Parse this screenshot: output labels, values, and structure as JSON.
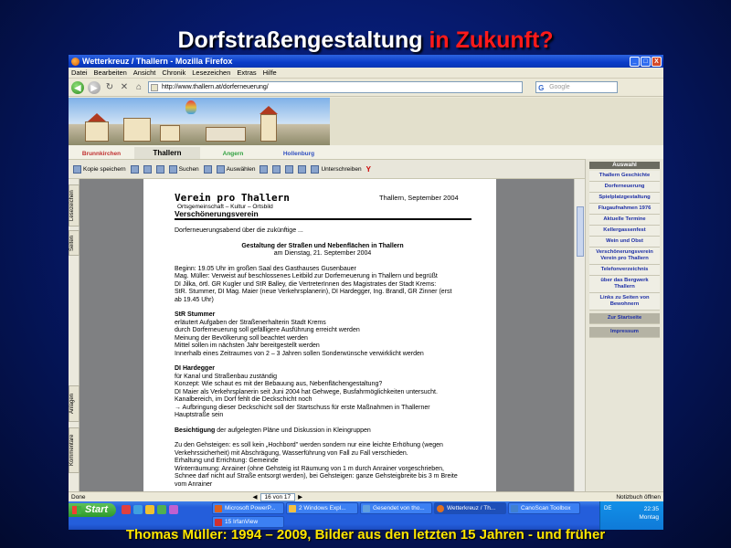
{
  "slide": {
    "title_main": "Dorfstraßengestaltung ",
    "title_highlight": "in Zukunft?",
    "footer": "Thomas Müller: 1994 – 2009, Bilder aus den letzten 15 Jahren - und früher"
  },
  "window": {
    "title": "Wetterkreuz / Thallern - Mozilla Firefox",
    "controls": [
      "_",
      "□",
      "X"
    ]
  },
  "menu": [
    "Datei",
    "Bearbeiten",
    "Ansicht",
    "Chronik",
    "Lesezeichen",
    "Extras",
    "Hilfe"
  ],
  "nav": {
    "url": "http://www.thallern.at/dorferneuerung/",
    "search_placeholder": "Google"
  },
  "site_tabs": [
    "Brunnkirchen",
    "Thallern",
    "Angern",
    "Hollenburg"
  ],
  "pdf_toolbar": [
    "Kopie speichern",
    "Suchen",
    "Auswählen",
    "Unterschreiben"
  ],
  "side_tabs": [
    "Lesezeichen",
    "Seiten",
    "Anlagen",
    "Kommentare"
  ],
  "document": {
    "org": "Verein pro Thallern",
    "org_sub": "Ortsgemeinschaft – Kultur – Ortsbild",
    "org_name": "Verschönerungsverein",
    "date": "Thallern,  September 2004",
    "intro": "Dorferneuerungsabend über die zukünftige ...",
    "heading1": "Gestaltung der Straßen und Nebenflächen in Thallern",
    "heading2": "am Dienstag, 21. September 2004",
    "p1": [
      "Beginn: 19.05 Uhr im großen Saal des Gasthauses Gusenbauer",
      "Mag. Müller: Verweist auf beschlossenes Leitbild zur Dorferneuerung in Thallern und begrüßt",
      "DI Jilka, örtl. GR Kugler und StR Balley, die VertreterInnen des Magistrates der Stadt Krems:",
      "StR. Stummer, DI Mag. Maier (neue Verkehrsplanerin), DI Hardegger, Ing. Brandl, GR Zinner (erst",
      "ab 19.45 Uhr)"
    ],
    "s2_title": "StR Stummer",
    "p2": [
      "erläutert Aufgaben der Straßenerhalterin Stadt Krems",
      "durch Dorferneuerung soll gefälligere Ausführung  erreicht werden",
      "Meinung der Bevölkerung soll beachtet werden",
      "Mittel sollen im nächsten Jahr  bereitgestellt werden",
      "Innerhalb eines Zeitraumes von  2 – 3 Jahren sollen Sonderwünsche verwirklicht werden"
    ],
    "s3_title": "DI Hardegger",
    "p3": [
      "für Kanal und Straßenbau zuständig",
      "Konzept: Wie schaut es mit der Bebauung aus, Nebenflächengestaltung?",
      "DI Maier  als Verkehrsplanerin seit Juni 2004 hat Gehwege, Busfahrmöglichkeiten untersucht.",
      "Kanalbereich, im Dorf fehlt die Deckschicht  noch",
      "→ Aufbringung dieser Deckschicht soll der Startschuss für erste Maßnahmen in Thallerner",
      "Hauptstraße sein"
    ],
    "s4_bold": "Besichtigung",
    "s4_rest": " der aufgelegten Pläne und Diskussion in Kleingruppen",
    "p5": [
      "Zu den Gehsteigen: es soll kein „Hochbord\" werden sondern nur eine leichte Erhöhung (wegen",
      "Verkehrssicherheit) mit Abschrägung, Wasserführung von Fall zu Fall verschieden.",
      "Erhaltung und Errichtung: Gemeinde",
      "Winterräumung: Anrainer (ohne Gehsteig ist Räumung  von  1 m durch Anrainer vorgeschrieben,",
      "Schnee darf nicht auf Straße entsorgt werden), bei Gehsteigen: ganze Gehsteigbreite bis 3 m Breite",
      "vom Anrainer"
    ]
  },
  "sidebar": {
    "header": "Auswahl",
    "items": [
      "Thallern Geschichte",
      "Dorferneuerung",
      "Spielplatzgestaltung",
      "Flugaufnahmen 1976",
      "Aktuelle Termine",
      "Kellergassenfest",
      "Wein und Obst",
      "Verschönerungsverein Verein pro Thallern",
      "Telefonverzeichnis",
      "über das Bergwerk Thallern",
      "Links zu Seiten von Bewohnern"
    ],
    "items_dark": [
      "Zur Startseite",
      "Impressum"
    ]
  },
  "status": {
    "left": "Done",
    "page_box": "16 von 17",
    "right": "Notizbuch öffnen"
  },
  "taskbar": {
    "start": "Start",
    "tasks": [
      "Microsoft PowerP...",
      "2 Windows Expl...",
      "Gesendet von tho...",
      "Wetterkreuz / Th...",
      "CanoScan Toolbox",
      "15 IrfanView"
    ],
    "lang": "DE",
    "time": "22:35",
    "day": "Montag"
  }
}
